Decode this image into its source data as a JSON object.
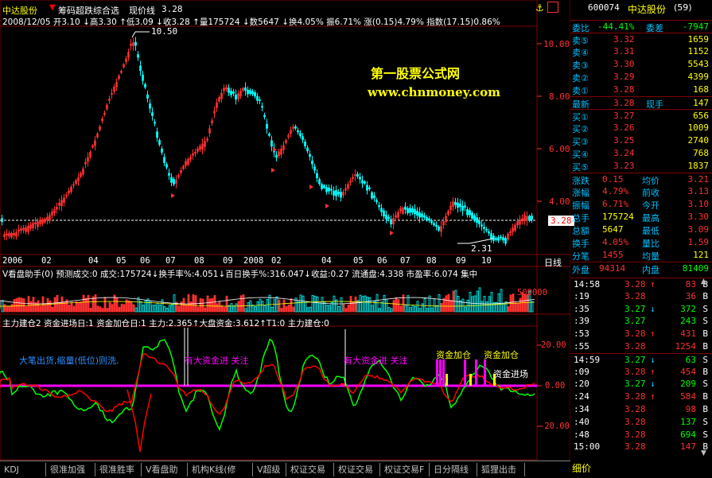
{
  "header": {
    "stock_name": "中达股份",
    "indicator_title": "筹码超跌综合选",
    "price_line_label": "现价线",
    "price_line_value": "3.28",
    "info_line": "2008/12/05 开3.10 ↓高3.30 ↑低3.09 ↓收3.28 ↑量175724 ↓数5647 ↓换4.05% 振6.71% 涨(0.15)4.79% 指数(17.15)0.86%"
  },
  "watermark": {
    "line1": "第一股票公式网",
    "line2": "www.chnmoney.com"
  },
  "price_axis": [
    "10.00",
    "8.00",
    "6.00",
    "4.00"
  ],
  "annotations": {
    "high": "10.50",
    "low": "2.31",
    "current": "3.28"
  },
  "date_axis": [
    "2006",
    "02",
    "04",
    "05",
    "06",
    "07",
    "08",
    "09",
    "2008",
    "02",
    "04",
    "05",
    "06",
    "07",
    "08",
    "09",
    "10"
  ],
  "date_axis_end": "日线",
  "volume_panel": {
    "info": "V看盘助手(0) 预测成交:0 成交:175724↓换手率%:4.051↓百日换手%:316.047↓收益:0.27 流通盘:4.338 市盈率:6.074 集中",
    "axis": "500000"
  },
  "fund_panel": {
    "info": "主力建仓2 资金进场日:1 资金加仓日:1 主力:2.365↑大盘资金:3.612↑T1:0 主力建仓:0",
    "axis": [
      "20.00",
      "0.00",
      "-20.00"
    ],
    "text_big_sell": "大笔出货,缩量(低位)则洗.",
    "text_big_buy_1": "有大资金进 关注",
    "text_big_buy_2": "有大资金进 关注",
    "text_add_1": "资金加仓",
    "text_add_2": "资金加仓",
    "text_entry": "资金进场"
  },
  "tabs": [
    "KDJ",
    "很准加强",
    "很准胜率",
    "V看盘助手",
    "机构K线(修",
    "V超级MACD",
    "权证交易B",
    "权证交易C",
    "权证交易F",
    "日分隔线",
    "狐狸出击"
  ],
  "quote": {
    "code": "600074",
    "name": "中达股份",
    "count": "(59)",
    "wei_bi_label": "委比",
    "wei_bi": "-44.41%",
    "wei_cha_label": "委差",
    "wei_cha": "-7947",
    "sells": [
      {
        "label": "卖⑤",
        "price": "3.32",
        "vol": "1659"
      },
      {
        "label": "卖④",
        "price": "3.31",
        "vol": "1152"
      },
      {
        "label": "卖③",
        "price": "3.30",
        "vol": "5543"
      },
      {
        "label": "卖②",
        "price": "3.29",
        "vol": "4399"
      },
      {
        "label": "卖①",
        "price": "3.28",
        "vol": "168"
      }
    ],
    "last_label": "最新",
    "last": "3.28",
    "now_hand_label": "现手",
    "now_hand": "147",
    "buys": [
      {
        "label": "买①",
        "price": "3.27",
        "vol": "656"
      },
      {
        "label": "买②",
        "price": "3.26",
        "vol": "1009"
      },
      {
        "label": "买③",
        "price": "3.25",
        "vol": "2740"
      },
      {
        "label": "买④",
        "price": "3.24",
        "vol": "768"
      },
      {
        "label": "买⑤",
        "price": "3.23",
        "vol": "1837"
      }
    ],
    "stats": [
      {
        "l1": "涨跌",
        "v1": "0.15",
        "l2": "均价",
        "v2": "3.21"
      },
      {
        "l1": "涨幅",
        "v1": "4.79%",
        "l2": "前收",
        "v2": "3.13"
      },
      {
        "l1": "振幅",
        "v1": "6.71%",
        "l2": "今开",
        "v2": "3.10"
      },
      {
        "l1": "总手",
        "v1": "175724",
        "l2": "最高",
        "v2": "3.30"
      },
      {
        "l1": "总额",
        "v1": "5647",
        "l2": "最低",
        "v2": "3.09"
      },
      {
        "l1": "换手",
        "v1": "4.05%",
        "l2": "量比",
        "v2": "1.59"
      },
      {
        "l1": "分笔",
        "v1": "1455",
        "l2": "均量",
        "v2": "121"
      }
    ],
    "outer_label": "外盘",
    "outer": "94314",
    "inner_label": "内盘",
    "inner": "81409",
    "ticks": [
      {
        "t": "14:58",
        "p": "3.28",
        "a": "↑",
        "v": "83",
        "bs": "B"
      },
      {
        "t": ":19",
        "p": "3.28",
        "a": "",
        "v": "36",
        "bs": "B"
      },
      {
        "t": ":35",
        "p": "3.27",
        "a": "↓",
        "v": "372",
        "bs": "S"
      },
      {
        "t": ":39",
        "p": "3.27",
        "a": "",
        "v": "243",
        "bs": "S"
      },
      {
        "t": ":53",
        "p": "3.28",
        "a": "↑",
        "v": "431",
        "bs": "B"
      },
      {
        "t": ":55",
        "p": "3.28",
        "a": "",
        "v": "1254",
        "bs": "B"
      },
      {
        "t": "14:59",
        "p": "3.27",
        "a": "↓",
        "v": "63",
        "bs": "S"
      },
      {
        "t": ":09",
        "p": "3.28",
        "a": "↑",
        "v": "454",
        "bs": "B"
      },
      {
        "t": ":20",
        "p": "3.27",
        "a": "↓",
        "v": "209",
        "bs": "S"
      },
      {
        "t": ":24",
        "p": "3.28",
        "a": "↑",
        "v": "584",
        "bs": "B"
      },
      {
        "t": ":34",
        "p": "3.28",
        "a": "",
        "v": "98",
        "bs": "B"
      },
      {
        "t": ":40",
        "p": "3.28",
        "a": "",
        "v": "137",
        "bs": "S"
      },
      {
        "t": ":48",
        "p": "3.28",
        "a": "",
        "v": "694",
        "bs": "S"
      },
      {
        "t": "15:00",
        "p": "3.28",
        "a": "",
        "v": "147",
        "bs": "B"
      }
    ],
    "bottom_label": "细价"
  },
  "colors": {
    "up": "#ff3030",
    "down": "#00ffff",
    "yellow": "#ffff00",
    "green": "#00ff00",
    "magenta": "#ff00ff",
    "grid": "#800000"
  }
}
